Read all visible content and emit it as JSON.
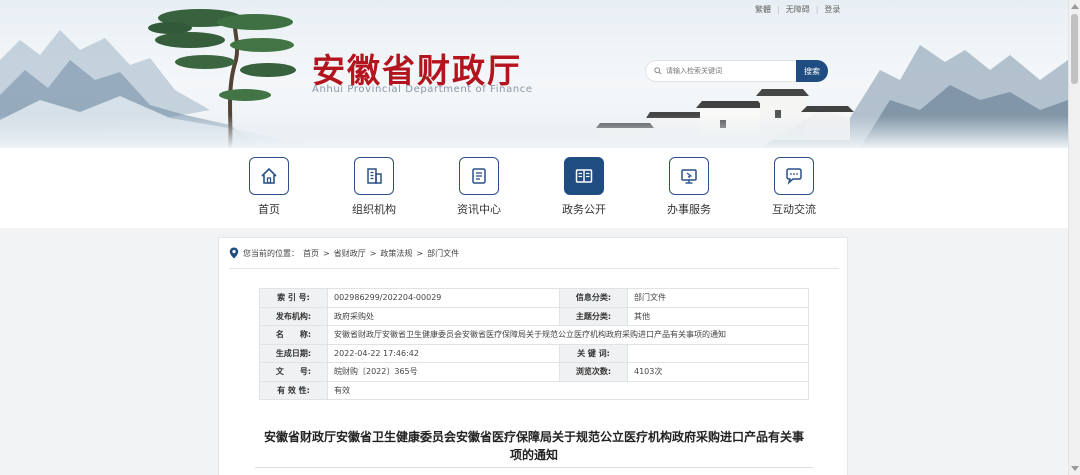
{
  "header": {
    "top_links": [
      "繁體",
      "无障碍",
      "登录"
    ],
    "title": "安徽省财政厅",
    "subtitle": "Anhui Provincial Department of Finance",
    "search_placeholder": "请输入检索关键词",
    "search_button": "搜索"
  },
  "nav": {
    "items": [
      {
        "label": "首页",
        "icon": "home-icon"
      },
      {
        "label": "组织机构",
        "icon": "building-icon"
      },
      {
        "label": "资讯中心",
        "icon": "news-icon"
      },
      {
        "label": "政务公开",
        "icon": "book-icon"
      },
      {
        "label": "办事服务",
        "icon": "monitor-icon"
      },
      {
        "label": "互动交流",
        "icon": "chat-icon"
      }
    ],
    "active_label": "政务公开"
  },
  "breadcrumb": {
    "prefix": "您当前的位置：",
    "items": [
      "首页",
      "省财政厅",
      "政策法规",
      "部门文件"
    ],
    "separator": ">"
  },
  "meta_table": {
    "rows": [
      {
        "k1": "索 引 号:",
        "v1": "002986299/202204-00029",
        "k2": "信息分类:",
        "v2": "部门文件"
      },
      {
        "k1": "发布机构:",
        "v1": "政府采购处",
        "k2": "主题分类:",
        "v2": "其他"
      },
      {
        "k1": "名　　称:",
        "v1": "安徽省财政厅安徽省卫生健康委员会安徽省医疗保障局关于规范公立医疗机构政府采购进口产品有关事项的通知"
      },
      {
        "k1": "生成日期:",
        "v1": "2022-04-22 17:46:42",
        "k2": "关 键 词:",
        "v2": ""
      },
      {
        "k1": "文　　号:",
        "v1": "皖财购〔2022〕365号",
        "k2": "浏览次数:",
        "v2": "4103次"
      },
      {
        "k1": "有 效 性:",
        "v1": "有效"
      }
    ]
  },
  "document": {
    "title_line1": "安徽省财政厅安徽省卫生健康委员会安徽省医疗保障局关于规范公立医疗机构政府采购进口产品有关事",
    "title_line2": "项的通知"
  },
  "colors": {
    "brand_red": "#b3141e",
    "nav_blue": "#1f4d82",
    "table_key_bg": "#f0f1f3"
  }
}
